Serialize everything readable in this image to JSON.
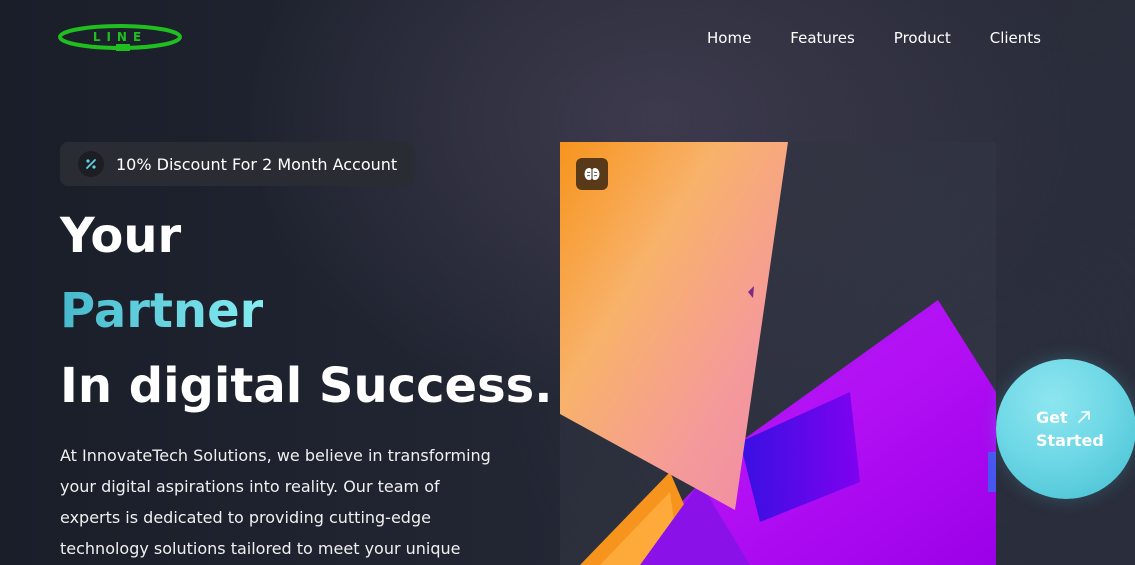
{
  "logo": {
    "text": "LINE",
    "color": "#1fbf1f"
  },
  "nav": {
    "items": [
      {
        "label": "Home"
      },
      {
        "label": "Features"
      },
      {
        "label": "Product"
      },
      {
        "label": "Clients"
      }
    ]
  },
  "promo": {
    "icon": "percent-icon",
    "text": "10% Discount For 2 Month Account"
  },
  "hero": {
    "headline_line1": "Your",
    "headline_line2": "Partner",
    "headline_line3": "In digital Success.",
    "accent_color": "#5fd3e0",
    "description": "At InnovateTech Solutions, we believe in transforming your digital aspirations into reality. Our team of experts is dedicated to providing cutting-edge technology solutions tailored to meet your unique",
    "badge_icon": "brain-icon"
  },
  "cta": {
    "label_line1": "Get",
    "label_line2": "Started",
    "icon": "arrow-up-right-icon",
    "color": "#6fd8e6"
  }
}
